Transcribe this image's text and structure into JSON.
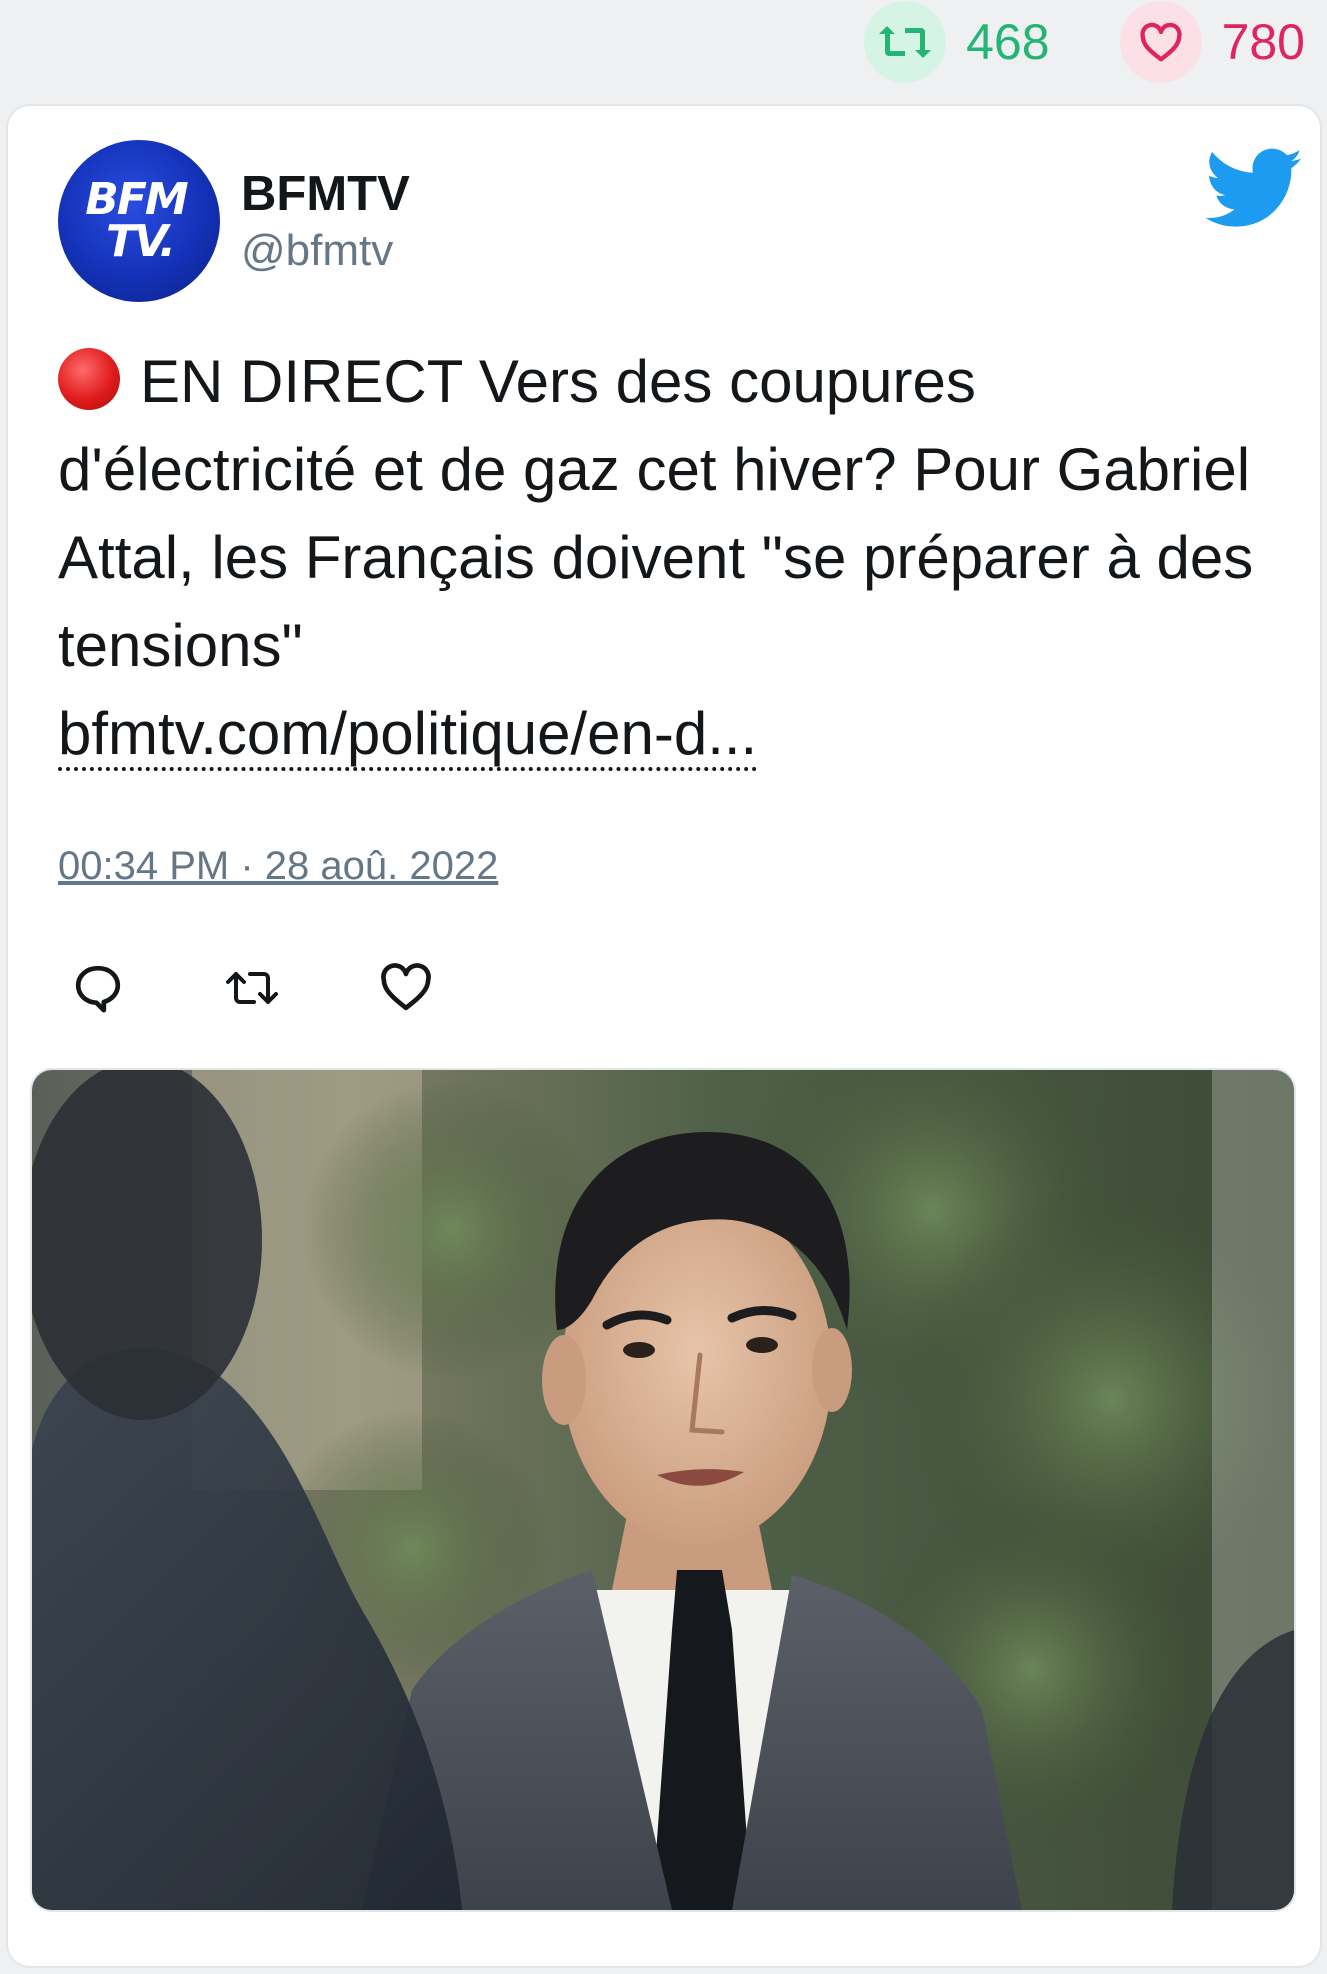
{
  "stats": {
    "retweets": "468",
    "likes": "780",
    "retweet_icon": "retweet-icon",
    "like_icon": "heart-icon",
    "retweet_color": "#22b573",
    "like_color": "#e0245e"
  },
  "tweet": {
    "avatar_line1": "BFM",
    "avatar_line2": "TV.",
    "author_name": "BFMTV",
    "author_handle": "@bfmtv",
    "live_marker": "red-circle-emoji",
    "text": "EN DIRECT Vers des coupures d'électricité et de gaz cet hiver? Pour Gabriel Attal, les Français doivent \"se préparer à des tensions\"",
    "link": "bfmtv.com/politique/en-d...",
    "timestamp": "00:34 PM · 28 aoû. 2022",
    "actions": [
      "reply-icon",
      "retweet-icon",
      "like-icon"
    ],
    "brand_color": "#1d9bf0",
    "avatar_color": "#1432b8"
  }
}
